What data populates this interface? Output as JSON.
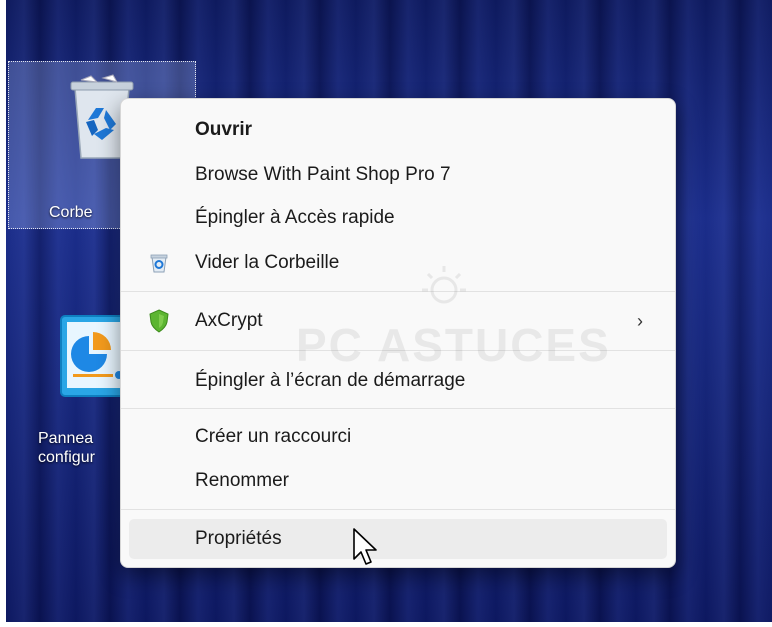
{
  "desktop": {
    "icons": [
      {
        "label": "Corbe",
        "selected": true
      },
      {
        "label": "Pannea\nconfigur",
        "selected": false
      }
    ]
  },
  "context_menu": {
    "items": [
      {
        "label": "Ouvrir"
      },
      {
        "label": "Browse With Paint Shop Pro 7"
      },
      {
        "label": "Épingler à Accès rapide"
      },
      {
        "label": "Vider la Corbeille",
        "icon": "recycle-bin-small-icon"
      },
      {
        "label": "AxCrypt",
        "icon": "axcrypt-shield-icon",
        "submenu_arrow": "›"
      },
      {
        "label": "Épingler à l’écran de démarrage"
      },
      {
        "label": "Créer un raccourci"
      },
      {
        "label": "Renommer"
      },
      {
        "label": "Propriétés",
        "hovered": true
      }
    ]
  },
  "watermark": {
    "text": "PC ASTUCES"
  },
  "colors": {
    "menu_bg": "#f9f9f9",
    "hover_bg": "#ececec",
    "desktop_blue": "#16267a",
    "axcrypt_green": "#5cb531"
  }
}
